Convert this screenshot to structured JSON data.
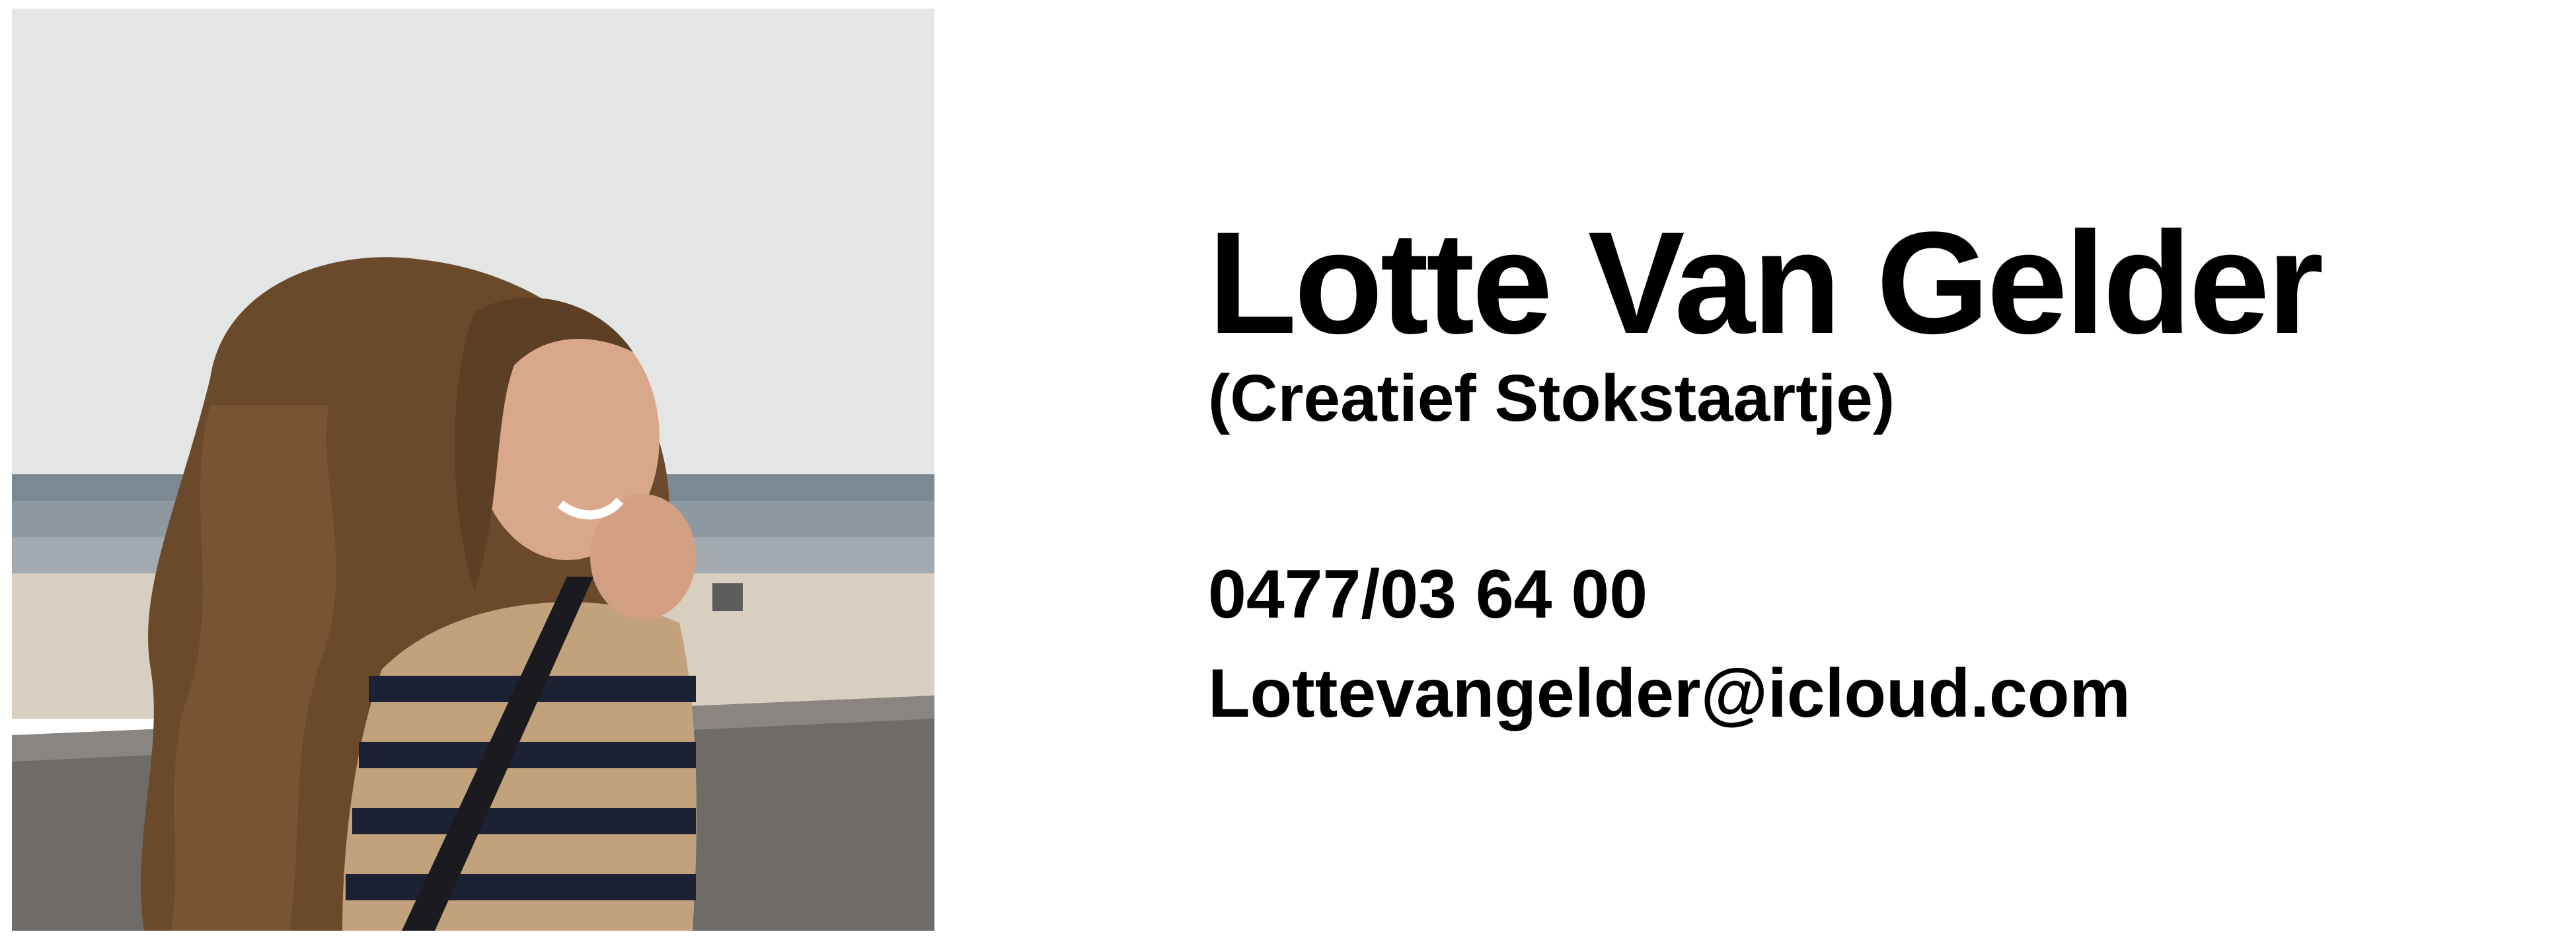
{
  "profile": {
    "name": "Lotte Van Gelder",
    "nickname": "(Creatief Stokstaartje)",
    "phone": "0477/03 64 00",
    "email": "Lottevangelder@icloud.com"
  },
  "photo": {
    "subject": "portrait-beach",
    "colors": {
      "sky": "#e4e6e6",
      "sea": "#8a949c",
      "sand": "#d8cfc0",
      "wall": "#6f6b66",
      "hair": "#6b4a2c",
      "shirt_tan": "#c2a27c",
      "shirt_stripe": "#1c2233",
      "skin": "#d9a88a"
    }
  }
}
